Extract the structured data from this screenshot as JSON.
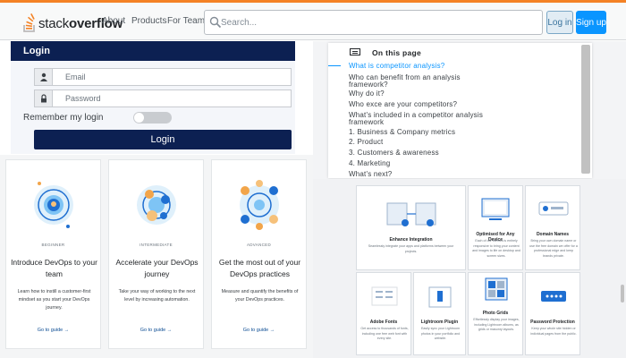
{
  "header": {
    "logo_prefix": "stack",
    "logo_bold": "overflow",
    "nav": [
      "About",
      "Products",
      "For Teams"
    ],
    "search_placeholder": "Search...",
    "login_label": "Log in",
    "signup_label": "Sign up",
    "accent_color": "#f48225",
    "primary_color": "#0a95ff"
  },
  "login": {
    "title": "Login",
    "email_placeholder": "Email",
    "password_placeholder": "Password",
    "remember_label": "Remember my login",
    "remember_on": false,
    "submit_label": "Login",
    "header_color": "#0c2052"
  },
  "cards": [
    {
      "level": "BEGINNER",
      "title": "Introduce DevOps to your team",
      "desc": "Learn how to instill a customer-first mindset as you start your DevOps journey.",
      "link": "Go to guide →"
    },
    {
      "level": "INTERMEDIATE",
      "title": "Accelerate your DevOps journey",
      "desc": "Take your way of working to the next level by increasing automation.",
      "link": "Go to guide →"
    },
    {
      "level": "ADVANCED",
      "title": "Get the most out of your DevOps practices",
      "desc": "Measure and quantify the benefits of your DevOps practices.",
      "link": "Go to guide →"
    }
  ],
  "toc": {
    "title": "On this page",
    "items": [
      {
        "text": "What is competitor analysis?",
        "active": true
      },
      {
        "text": "Who can benefit from an analysis",
        "active": false
      },
      {
        "text": "framework?",
        "active": false
      },
      {
        "text": "Why do it?",
        "active": false
      },
      {
        "text": "Who exce are your competitors?",
        "active": false
      },
      {
        "text": "What's included in a competitor analysis",
        "active": false
      },
      {
        "text": "framework",
        "active": false
      },
      {
        "text": "1. Business & Company metrics",
        "active": false
      },
      {
        "text": "2. Product",
        "active": false
      },
      {
        "text": "3. Customers & awareness",
        "active": false
      },
      {
        "text": "4. Marketing",
        "active": false
      },
      {
        "text": "What's next?",
        "active": false
      }
    ]
  },
  "features": [
    {
      "title": "Enhance Integration",
      "desc": "Seamlessly integrate your apps and platforms between your projects."
    },
    {
      "title": "Optimised for Any Device",
      "desc": "Each of our themes is entirely responsive to bring your content and images to life on desktop and screen sizes."
    },
    {
      "title": "Domain Names",
      "desc": "Bring your own domain name or use the free domain we offer for a professional edge and keep brands private."
    },
    {
      "title": "Adobe Fonts",
      "desc": "Get access to thousands of fonts, including one free web font with every site."
    },
    {
      "title": "Lightroom Plugin",
      "desc": "Easily sync your Lightroom photos in your portfolio and website."
    },
    {
      "title": "Photo Grids",
      "desc": "Effortlessly display your images, including Lightroom albums, as grids or masonry layouts."
    },
    {
      "title": "Password Protection",
      "desc": "Keep your whole site hidden or individual pages from the public."
    }
  ]
}
